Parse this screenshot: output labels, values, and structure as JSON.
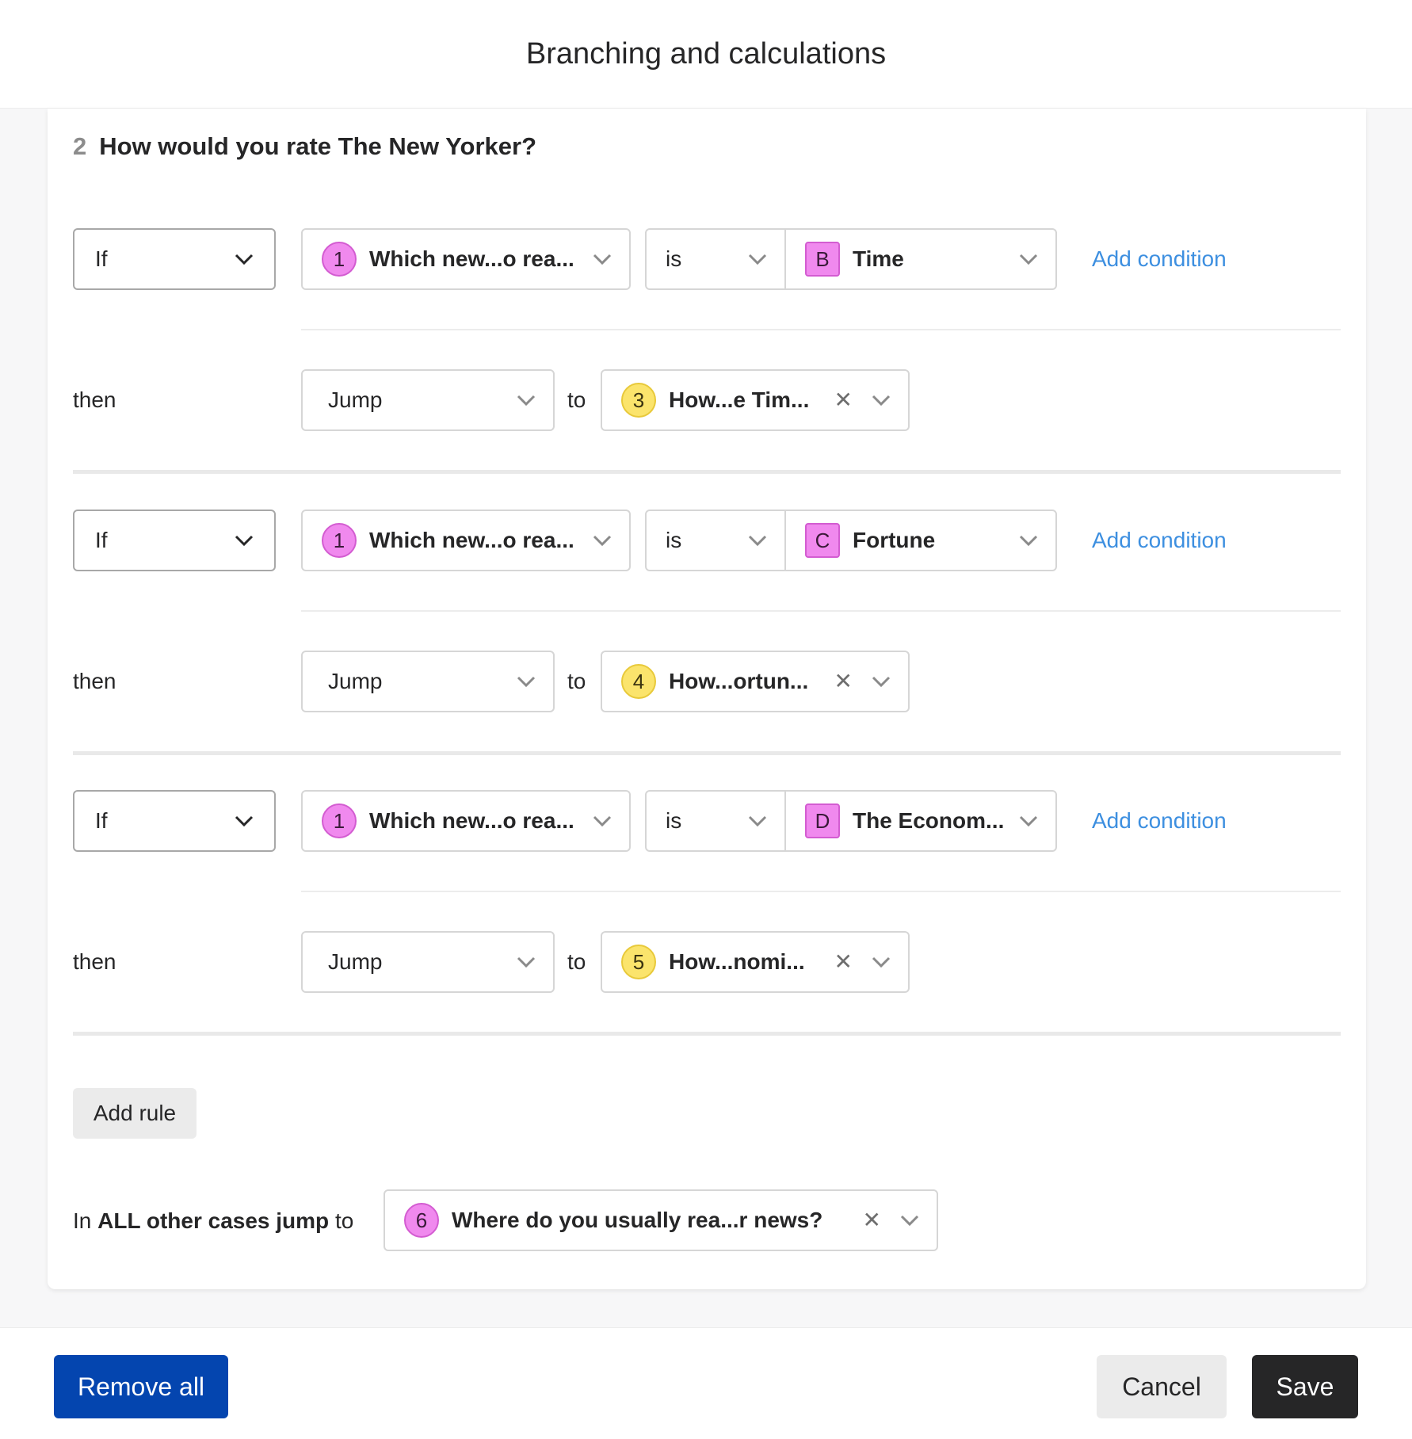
{
  "header": {
    "title": "Branching and calculations"
  },
  "question": {
    "number": "2",
    "text_plain": "How would you rate ",
    "text_bold": "The New Yorker?"
  },
  "rules": [
    {
      "if_label": "If",
      "question_num": "1",
      "question_text": "Which new...o rea...",
      "operator": "is",
      "answer_letter": "B",
      "answer_text": "Time",
      "add_condition": "Add condition",
      "then_label": "then",
      "action": "Jump",
      "to_label": "to",
      "target_num": "3",
      "target_text": "How...e Tim..."
    },
    {
      "if_label": "If",
      "question_num": "1",
      "question_text": "Which new...o rea...",
      "operator": "is",
      "answer_letter": "C",
      "answer_text": "Fortune",
      "add_condition": "Add condition",
      "then_label": "then",
      "action": "Jump",
      "to_label": "to",
      "target_num": "4",
      "target_text": "How...ortun..."
    },
    {
      "if_label": "If",
      "question_num": "1",
      "question_text": "Which new...o rea...",
      "operator": "is",
      "answer_letter": "D",
      "answer_text": "The Econom...",
      "add_condition": "Add condition",
      "then_label": "then",
      "action": "Jump",
      "to_label": "to",
      "target_num": "5",
      "target_text": "How...nomi..."
    }
  ],
  "add_rule_label": "Add rule",
  "other_cases": {
    "prefix": "In",
    "bold": "ALL other cases jump",
    "suffix": "to",
    "target_num": "6",
    "target_text": "Where do you usually rea...r news?"
  },
  "footer": {
    "remove_all": "Remove all",
    "cancel": "Cancel",
    "save": "Save"
  },
  "icons": {
    "dropdown": "chevron-down-icon",
    "clear": "close-icon"
  },
  "colors": {
    "link": "#3d8fe0",
    "primary": "#0445af",
    "save": "#262627",
    "pink_badge": "#f089ee",
    "yellow_badge": "#fbe46c"
  }
}
